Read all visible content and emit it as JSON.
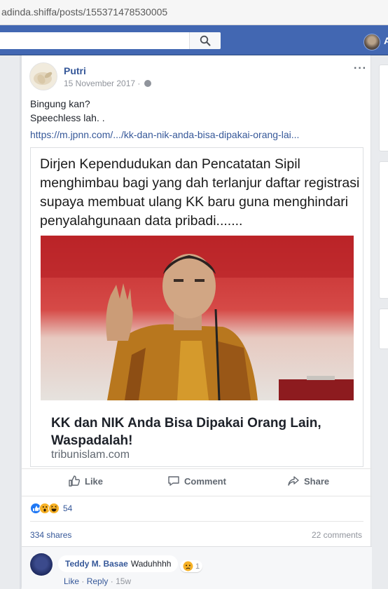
{
  "browser": {
    "url": "adinda.shiffa/posts/155371478530005"
  },
  "topbar": {
    "user_initial": "A"
  },
  "post": {
    "author": "Putri",
    "date": "15 November 2017 ·",
    "text_line1": "Bingung kan?",
    "text_line2": "Speechless lah. .",
    "link": "https://m.jpnn.com/.../kk-dan-nik-anda-bisa-dipakai-orang-lai...",
    "attachment": {
      "caption": "Dirjen Kependudukan dan Pencatatan Sipil menghimbau bagi yang dah terlanjur daftar registrasi supaya membuat ulang KK baru guna menghindari penyalahgunaan data pribadi.......",
      "headline": "KK dan NIK Anda Bisa Dipakai Orang Lain, Waspadalah!",
      "domain": "tribunislam.com"
    },
    "actions": {
      "like": "Like",
      "comment": "Comment",
      "share": "Share"
    },
    "reaction_count": "54",
    "shares": "334 shares",
    "comments": "22 comments",
    "comment": {
      "name": "Teddy M. Basae",
      "text": "Waduhhhh",
      "reaction_count": "1",
      "like": "Like",
      "reply": "Reply",
      "time": "15w"
    }
  },
  "colors": {
    "fb_blue": "#4267b2",
    "link": "#365899",
    "like_blue": "#2078f4",
    "haha_yellow": "#f7b125"
  }
}
